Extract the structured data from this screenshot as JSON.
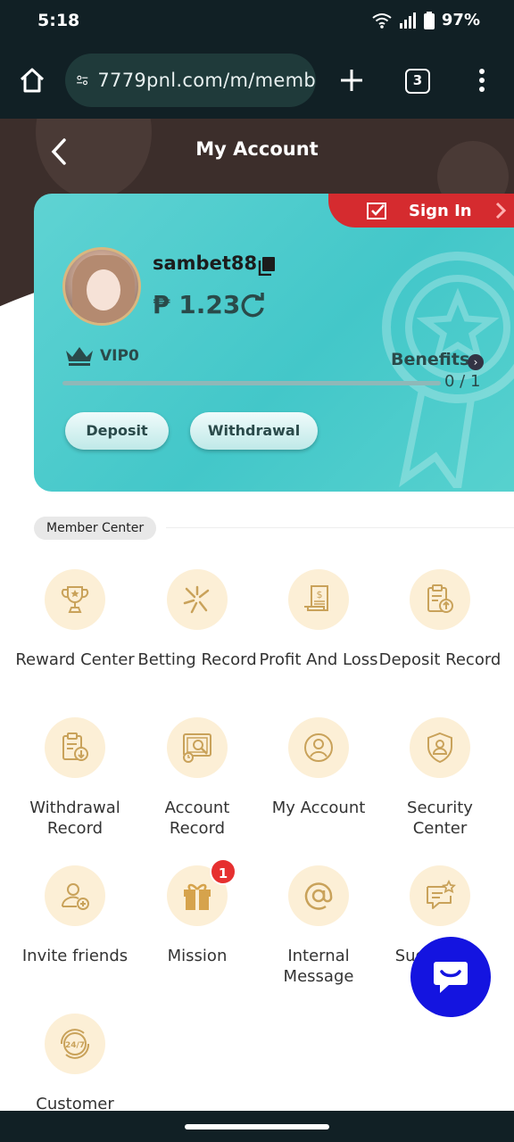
{
  "status": {
    "time": "5:18",
    "battery": "97%"
  },
  "browser": {
    "url": "7779pnl.com/m/memb",
    "tab_count": "3"
  },
  "header": {
    "title": "My Account"
  },
  "card": {
    "signin_label": "Sign In",
    "username": "sambet88",
    "balance": "₱ 1.23",
    "vip_label": "VIP0",
    "benefits_label": "Benefits",
    "progress_text": "0 / 1",
    "progress_fraction": 0,
    "deposit_label": "Deposit",
    "withdrawal_label": "Withdrawal"
  },
  "member_center": {
    "title": "Member Center",
    "items": [
      {
        "label": "Reward Center",
        "icon": "trophy-icon"
      },
      {
        "label": "Betting Record",
        "icon": "betting-icon"
      },
      {
        "label": "Profit And Loss",
        "icon": "receipt-icon"
      },
      {
        "label": "Deposit Record",
        "icon": "clipboard-upload-icon"
      },
      {
        "label": "Withdrawal Record",
        "icon": "clipboard-download-icon"
      },
      {
        "label": "Account Record",
        "icon": "account-record-icon"
      },
      {
        "label": "My Account",
        "icon": "user-circle-icon"
      },
      {
        "label": "Security Center",
        "icon": "shield-user-icon"
      },
      {
        "label": "Invite friends",
        "icon": "invite-user-icon"
      },
      {
        "label": "Mission",
        "icon": "gift-icon",
        "badge": "1"
      },
      {
        "label": "Internal Message",
        "icon": "at-sign-icon"
      },
      {
        "label": "Suggestion",
        "icon": "feedback-icon"
      },
      {
        "label": "Customer",
        "icon": "support-24-7-icon"
      }
    ]
  },
  "colors": {
    "card": "#4ccbcb",
    "signin": "#d52b2f",
    "icon_bg": "#fcefd6",
    "icon_stroke": "#c9a25a",
    "fab": "#1414e0"
  }
}
